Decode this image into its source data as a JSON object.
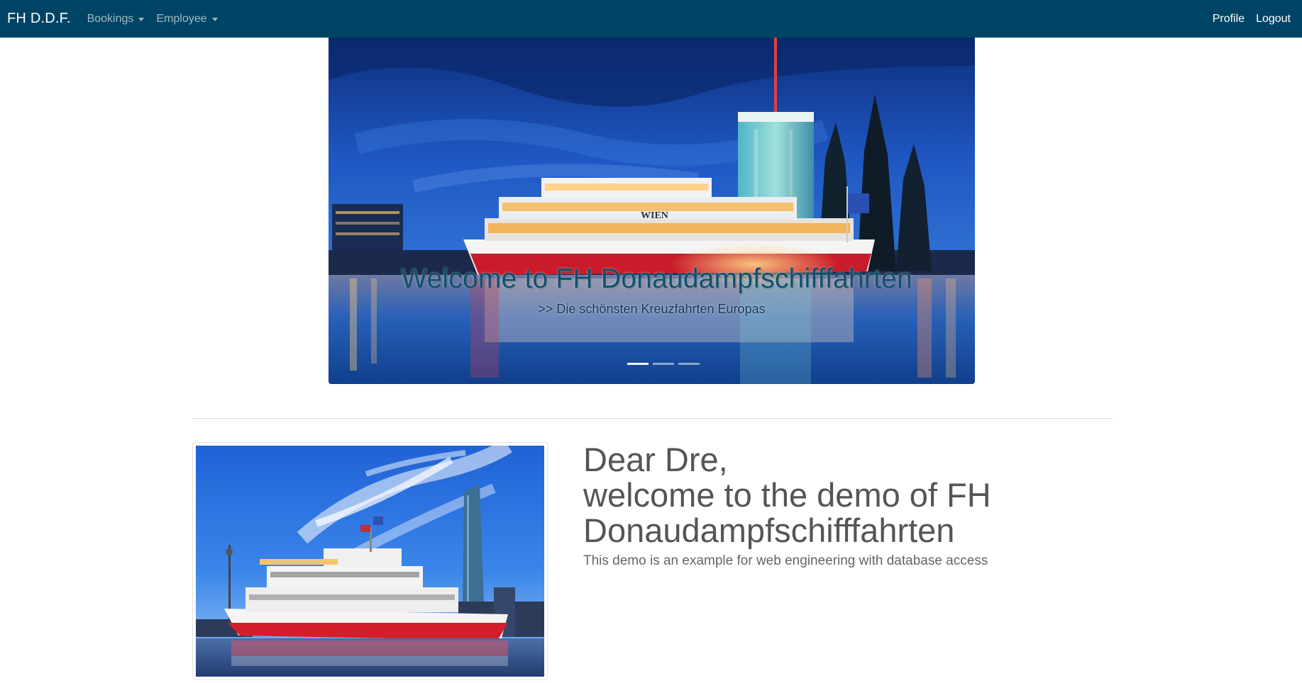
{
  "navbar": {
    "brand": "FH D.D.F.",
    "menus": [
      {
        "label": "Bookings"
      },
      {
        "label": "Employee"
      }
    ],
    "right_links": [
      {
        "label": "Profile"
      },
      {
        "label": "Logout"
      }
    ],
    "background_color": "#004465"
  },
  "carousel": {
    "caption_title": "Welcome to FH Donaudampfschifffahrten",
    "caption_subtitle": ">> Die schönsten Kreuzfahrten Europas",
    "slide_count": 3,
    "active_slide": 1,
    "ship_name": "WIEN"
  },
  "content": {
    "greeting": "Dear Dre,",
    "heading_line2": "welcome to the demo of FH",
    "heading_line3": "Donaudampfschifffahrten",
    "lead": "This demo is an example for web engineering with database access"
  },
  "colors": {
    "navbar": "#004465",
    "caption": "#11506f",
    "heading_text": "#555555"
  }
}
